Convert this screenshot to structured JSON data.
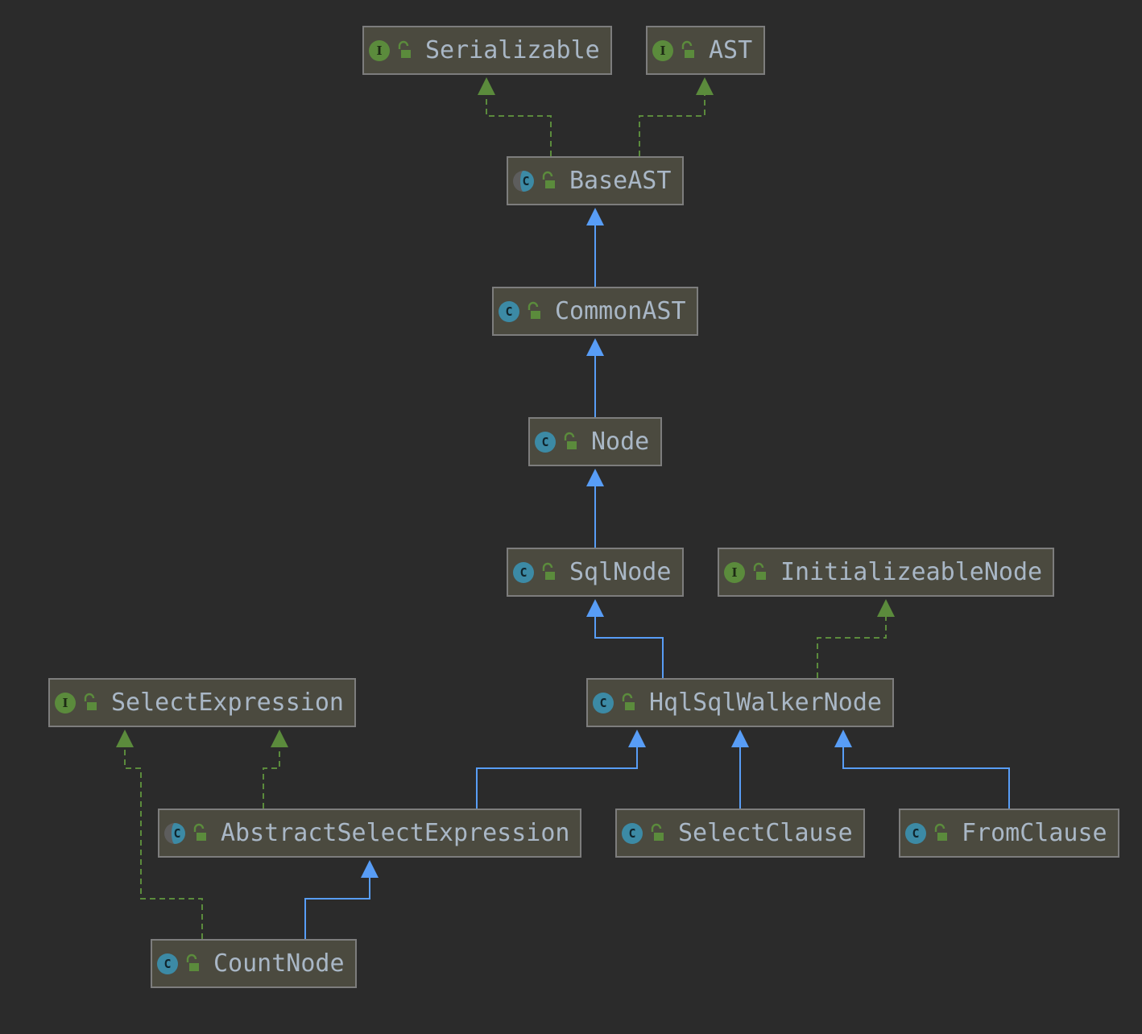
{
  "diagram": {
    "nodes": [
      {
        "id": "serializable",
        "kind": "interface",
        "badge": "I",
        "icon": "public-lock-icon",
        "label": "Serializable"
      },
      {
        "id": "ast",
        "kind": "interface",
        "badge": "I",
        "icon": "public-lock-icon",
        "label": "AST"
      },
      {
        "id": "baseast",
        "kind": "abstract",
        "badge": "C",
        "icon": "public-lock-icon",
        "label": "BaseAST"
      },
      {
        "id": "commonast",
        "kind": "class",
        "badge": "C",
        "icon": "public-lock-icon",
        "label": "CommonAST"
      },
      {
        "id": "node",
        "kind": "class",
        "badge": "C",
        "icon": "public-lock-icon",
        "label": "Node"
      },
      {
        "id": "sqlnode",
        "kind": "class",
        "badge": "C",
        "icon": "public-lock-icon",
        "label": "SqlNode"
      },
      {
        "id": "initializeablenode",
        "kind": "interface",
        "badge": "I",
        "icon": "public-lock-icon",
        "label": "InitializeableNode"
      },
      {
        "id": "selectexpression",
        "kind": "interface",
        "badge": "I",
        "icon": "public-lock-icon",
        "label": "SelectExpression"
      },
      {
        "id": "hqlsqlwalkernode",
        "kind": "class",
        "badge": "C",
        "icon": "public-lock-icon",
        "label": "HqlSqlWalkerNode"
      },
      {
        "id": "abstractselectexpression",
        "kind": "abstract",
        "badge": "C",
        "icon": "public-lock-icon",
        "label": "AbstractSelectExpression"
      },
      {
        "id": "selectclause",
        "kind": "class",
        "badge": "C",
        "icon": "public-lock-icon",
        "label": "SelectClause"
      },
      {
        "id": "fromclause",
        "kind": "class",
        "badge": "C",
        "icon": "public-lock-icon",
        "label": "FromClause"
      },
      {
        "id": "countnode",
        "kind": "class",
        "badge": "C",
        "icon": "public-lock-icon",
        "label": "CountNode"
      }
    ],
    "edges": [
      {
        "from": "baseast",
        "to": "serializable",
        "type": "implements"
      },
      {
        "from": "baseast",
        "to": "ast",
        "type": "implements"
      },
      {
        "from": "commonast",
        "to": "baseast",
        "type": "extends"
      },
      {
        "from": "node",
        "to": "commonast",
        "type": "extends"
      },
      {
        "from": "sqlnode",
        "to": "node",
        "type": "extends"
      },
      {
        "from": "hqlsqlwalkernode",
        "to": "sqlnode",
        "type": "extends"
      },
      {
        "from": "hqlsqlwalkernode",
        "to": "initializeablenode",
        "type": "implements"
      },
      {
        "from": "abstractselectexpression",
        "to": "hqlsqlwalkernode",
        "type": "extends"
      },
      {
        "from": "selectclause",
        "to": "hqlsqlwalkernode",
        "type": "extends"
      },
      {
        "from": "fromclause",
        "to": "hqlsqlwalkernode",
        "type": "extends"
      },
      {
        "from": "abstractselectexpression",
        "to": "selectexpression",
        "type": "implements"
      },
      {
        "from": "countnode",
        "to": "abstractselectexpression",
        "type": "extends"
      },
      {
        "from": "countnode",
        "to": "selectexpression",
        "type": "implements"
      }
    ],
    "colors": {
      "background": "#2b2b2b",
      "node_fill": "#4b4a3f",
      "node_border": "#7d7d7d",
      "label_text": "#a9b7c6",
      "extends_edge": "#589df6",
      "implements_edge": "#5b8b3c",
      "interface_badge": "#5b8b3c",
      "class_badge": "#3c8aa5"
    }
  }
}
